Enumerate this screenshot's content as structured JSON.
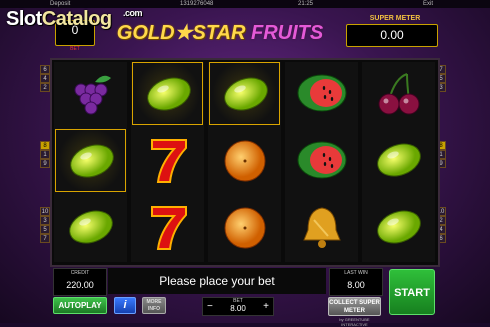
{
  "topbar": {
    "deposit": "Deposit",
    "balance": "1319276048",
    "time": "21:25",
    "exit": "Exit"
  },
  "watermark": {
    "slot": "Slot",
    "catalog": "Catalog",
    "com": ".com"
  },
  "bet_display": {
    "value": "0",
    "label": "BET"
  },
  "title": {
    "part1": "GOLD",
    "star": "★",
    "part2": "STAR",
    "part3": "FRUITS"
  },
  "super_meter": {
    "label": "SUPER METER",
    "value": "0.00"
  },
  "left_lines": [
    "6",
    "4",
    "2",
    "8",
    "1",
    "9",
    "10",
    "3",
    "5",
    "7"
  ],
  "right_lines": [
    "7",
    "5",
    "3",
    "8",
    "1",
    "9",
    "10",
    "2",
    "4",
    "6"
  ],
  "active_line": "8",
  "reels": [
    [
      {
        "symbol": "grapes-icon",
        "hl": false
      },
      {
        "symbol": "lemon-icon",
        "hl": true
      },
      {
        "symbol": "lemon-icon",
        "hl": false
      }
    ],
    [
      {
        "symbol": "lemon-icon",
        "hl": true
      },
      {
        "symbol": "seven-icon",
        "hl": false
      },
      {
        "symbol": "seven-icon",
        "hl": false
      }
    ],
    [
      {
        "symbol": "lemon-icon",
        "hl": true
      },
      {
        "symbol": "orange-icon",
        "hl": false
      },
      {
        "symbol": "orange-icon",
        "hl": false
      }
    ],
    [
      {
        "symbol": "watermelon-icon",
        "hl": false
      },
      {
        "symbol": "watermelon-icon",
        "hl": false
      },
      {
        "symbol": "bell-icon",
        "hl": false
      }
    ],
    [
      {
        "symbol": "cherries-icon",
        "hl": false
      },
      {
        "symbol": "lemon-icon",
        "hl": false
      },
      {
        "symbol": "lemon-icon",
        "hl": false
      }
    ]
  ],
  "credit": {
    "label": "CREDIT",
    "value": "220.00"
  },
  "message": "Please place your bet",
  "last_win": {
    "label": "LAST WIN",
    "value": "8.00"
  },
  "buttons": {
    "autoplay": "AUTOPLAY",
    "info": "i",
    "more_info": "MORE INFO",
    "collect": "COLLECT SUPER METER",
    "start": "START"
  },
  "bet_control": {
    "label": "BET",
    "value": "8.00",
    "minus": "−",
    "plus": "+"
  },
  "brand_note": "by GREENTUBE INTERACTIVE"
}
